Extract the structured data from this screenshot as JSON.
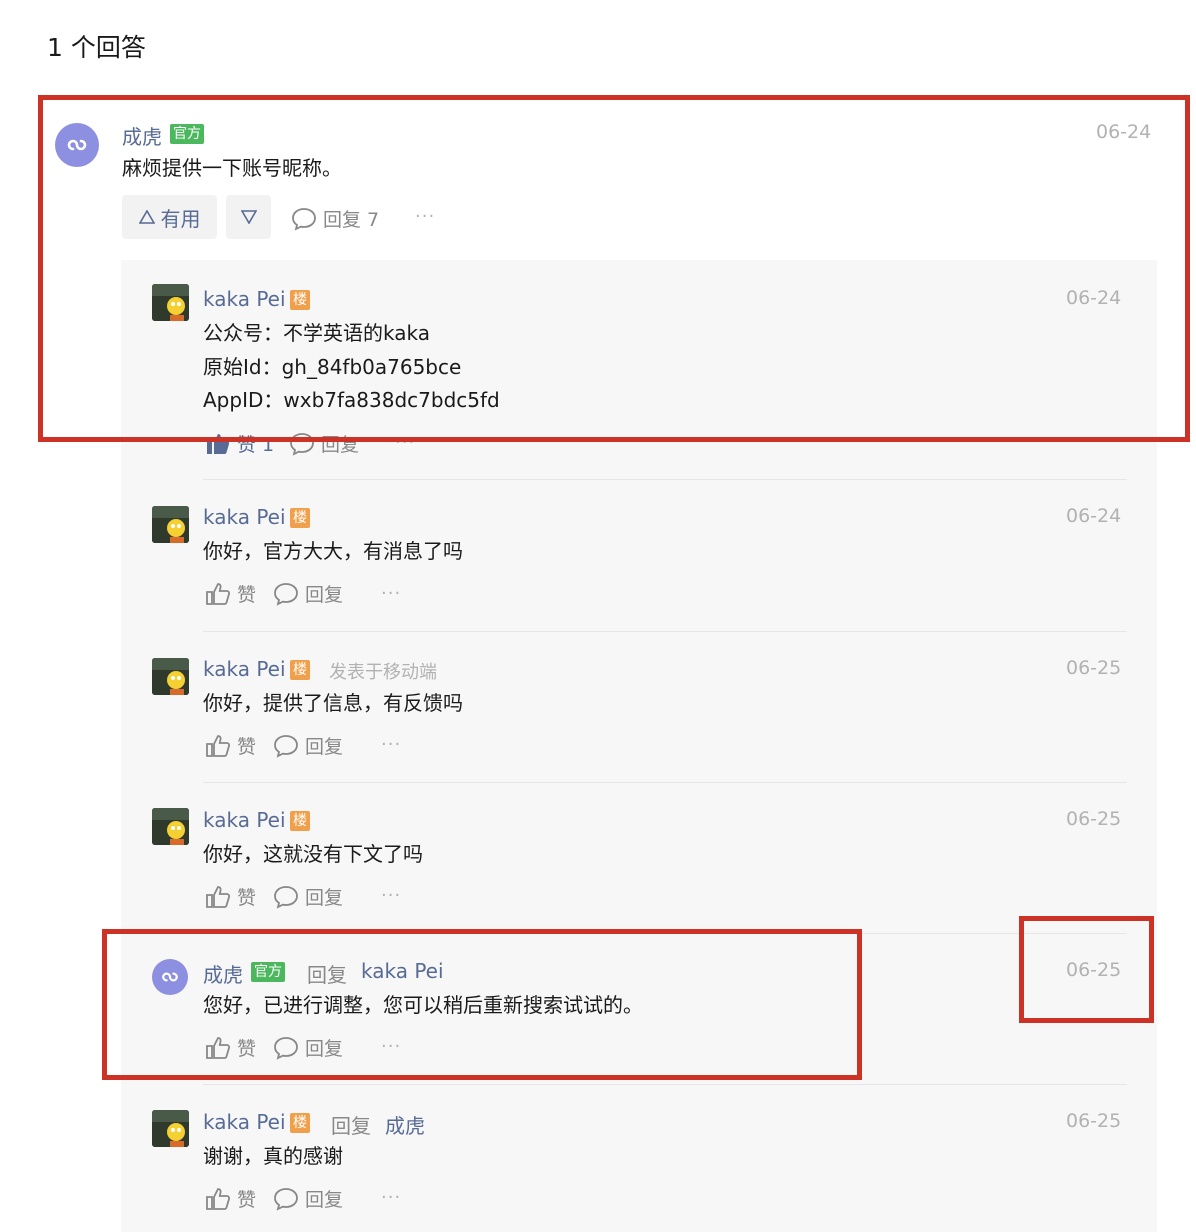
{
  "answers_count": "1 个回答",
  "answer": {
    "author": "成虎",
    "badge": "官方",
    "date": "06-24",
    "text": "麻烦提供一下账号昵称。",
    "useful_label": "有用",
    "reply_label": "回复 7"
  },
  "replies": [
    {
      "author": "kaka Pei",
      "badge": "楼",
      "date": "06-24",
      "lines": [
        "公众号：不学英语的kaka",
        "原始Id：gh_84fb0a765bce",
        "AppID：wxb7fa838dc7bdc5fd"
      ],
      "like_label": "赞 1",
      "reply_label": "回复"
    },
    {
      "author": "kaka Pei",
      "badge": "楼",
      "date": "06-24",
      "text": "你好，官方大大，有消息了吗",
      "like_label": "赞",
      "reply_label": "回复"
    },
    {
      "author": "kaka Pei",
      "badge": "楼",
      "source": "发表于移动端",
      "date": "06-25",
      "text": "你好，提供了信息，有反馈吗",
      "like_label": "赞",
      "reply_label": "回复"
    },
    {
      "author": "kaka Pei",
      "badge": "楼",
      "date": "06-25",
      "text": "你好，这就没有下文了吗",
      "like_label": "赞",
      "reply_label": "回复"
    },
    {
      "author": "成虎",
      "badge": "官方",
      "reply_word": "回复",
      "reply_to": "kaka Pei",
      "date": "06-25",
      "text": "您好，已进行调整，您可以稍后重新搜索试试的。",
      "like_label": "赞",
      "reply_label": "回复"
    },
    {
      "author": "kaka Pei",
      "badge": "楼",
      "reply_word": "回复",
      "reply_to": "成虎",
      "date": "06-25",
      "text": "谢谢，真的感谢",
      "like_label": "赞",
      "reply_label": "回复"
    }
  ],
  "more_icon": "ellipsis-icon",
  "colors": {
    "link": "#576b95",
    "official_badge": "#4cb85e",
    "lou_badge": "#f0a04b",
    "annotation_red": "#cc3326"
  }
}
